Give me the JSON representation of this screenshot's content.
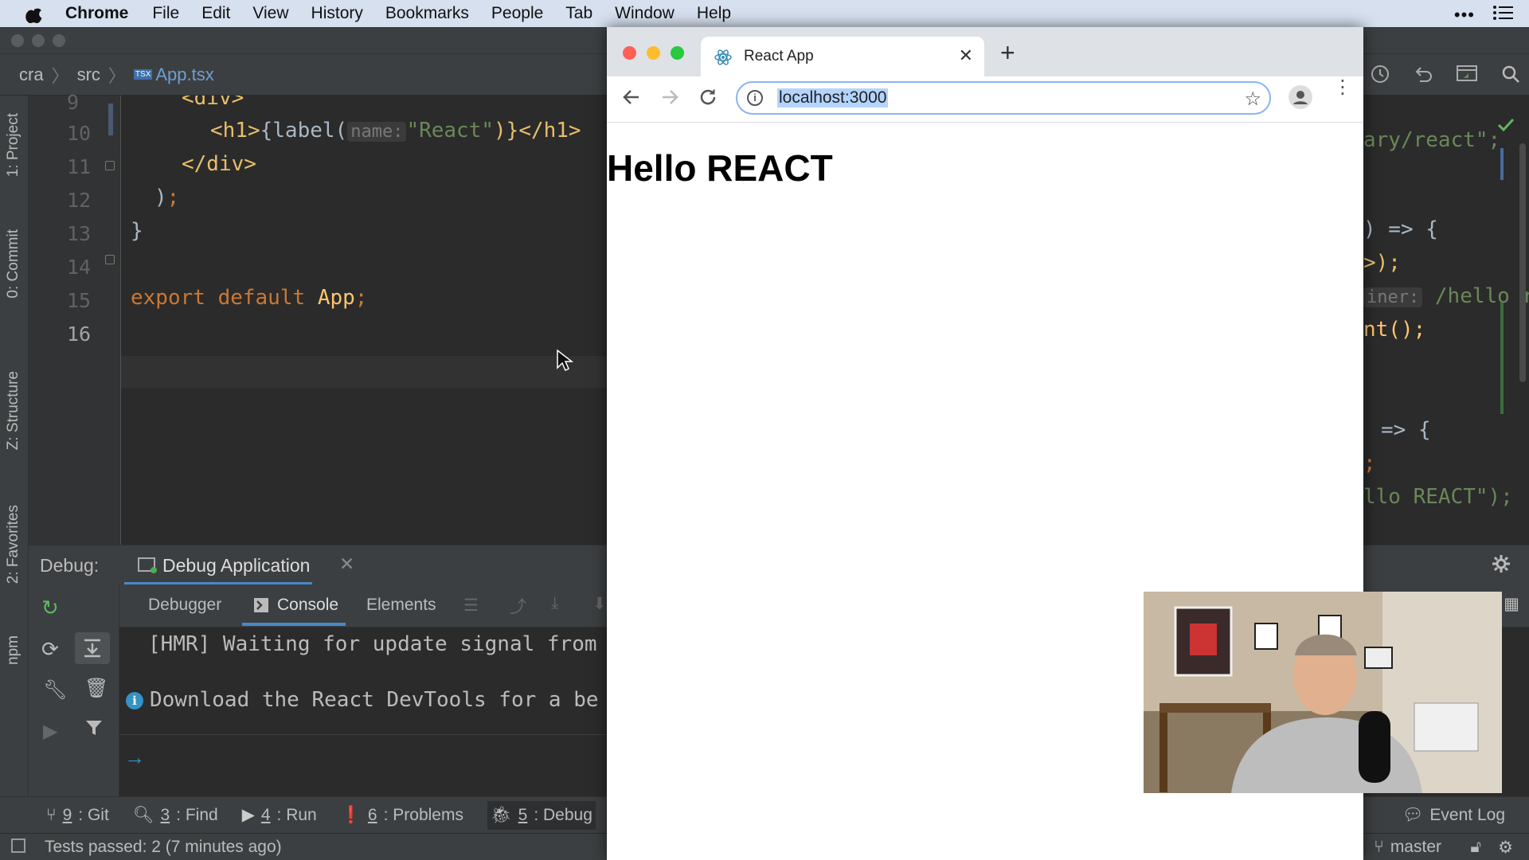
{
  "menubar": {
    "app_name": "Chrome",
    "items": [
      "File",
      "Edit",
      "View",
      "History",
      "Bookmarks",
      "People",
      "Tab",
      "Window",
      "Help"
    ]
  },
  "ide": {
    "breadcrumb": {
      "project": "cra",
      "folder": "src",
      "file": "App.tsx",
      "file_badge": "TSX"
    },
    "side_tabs": [
      "1: Project",
      "0: Commit",
      "Z: Structure",
      "2: Favorites",
      "npm"
    ],
    "line_numbers": [
      "9",
      "10",
      "11",
      "12",
      "13",
      "14",
      "15",
      "16"
    ],
    "code": {
      "l9": "<div>",
      "l10_open": "<h1>",
      "l10_call": "{label(",
      "l10_hint": "name:",
      "l10_str": "\"React\"",
      "l10_close": ")}</h1>",
      "l11": "</div>",
      "l12_paren": ")",
      "l12_semi": ";",
      "l13": "}",
      "l15_kw": "export default",
      "l15_name": "App",
      "l15_semi": ";"
    },
    "right_code": {
      "r1": "ary/react\";",
      "r2": ") => {",
      "r3": ">);",
      "r4_hint": "iner:",
      "r4_str": "/hello re",
      "r5": "nt();",
      "r6": "=> {",
      "r7": ";",
      "r8": "llo REACT\");"
    },
    "debug": {
      "label": "Debug:",
      "config": "Debug Application",
      "tabs": [
        "Debugger",
        "Console",
        "Elements"
      ],
      "console_lines": [
        "[HMR] Waiting for update signal from",
        "Download the React DevTools for a be"
      ],
      "prompt": "→"
    },
    "tool_windows": [
      {
        "num": "9",
        "label": ": Git"
      },
      {
        "num": "3",
        "label": ": Find"
      },
      {
        "num": "4",
        "label": ": Run"
      },
      {
        "num": "6",
        "label": ": Problems"
      },
      {
        "num": "5",
        "label": ": Debug"
      }
    ],
    "event_log": "Event Log",
    "status_text": "Tests passed: 2 (7 minutes ago)",
    "branch": "master"
  },
  "chrome": {
    "tab_title": "React App",
    "url": "localhost:3000",
    "page_heading": "Hello REACT"
  },
  "colors": {
    "ide_bg": "#2b2b2b",
    "keyword": "#cc7832",
    "tag": "#e8bf6a",
    "string": "#6a8759",
    "menubar": "#d6e0ef"
  }
}
